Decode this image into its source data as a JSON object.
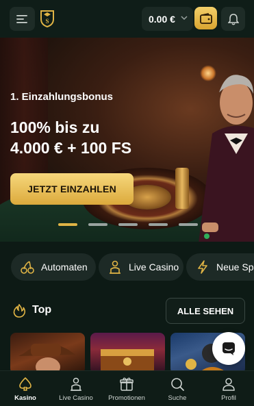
{
  "header": {
    "balance": "0.00 €",
    "icons": [
      "menu-icon",
      "brand-logo",
      "chevron-down-icon",
      "wallet-icon",
      "bell-icon"
    ]
  },
  "hero": {
    "subtitle": "1. Einzahlungsbonus",
    "title_line1": "100% bis zu",
    "title_line2": "4.000 € + 100 FS",
    "cta_label": "JETZT EINZAHLEN",
    "slide_count": 5,
    "active_slide": 1
  },
  "categories": [
    {
      "label": "Automaten",
      "icon": "cherries-icon"
    },
    {
      "label": "Live Casino",
      "icon": "dealer-icon"
    },
    {
      "label": "Neue Sp",
      "icon": "lightning-icon"
    }
  ],
  "top_section": {
    "title": "Top",
    "icon": "flame-icon",
    "see_all_label": "ALLE SEHEN"
  },
  "bottom_nav": [
    {
      "label": "Kasino",
      "icon": "spade-icon",
      "active": true
    },
    {
      "label": "Live Casino",
      "icon": "dealer-icon",
      "active": false
    },
    {
      "label": "Promotionen",
      "icon": "gift-icon",
      "active": false
    },
    {
      "label": "Suche",
      "icon": "search-icon",
      "active": false
    },
    {
      "label": "Profil",
      "icon": "profile-icon",
      "active": false
    }
  ],
  "colors": {
    "background": "#0d1a15",
    "accent_gold": "#e0b445",
    "pill_bg": "#1d2a26"
  }
}
